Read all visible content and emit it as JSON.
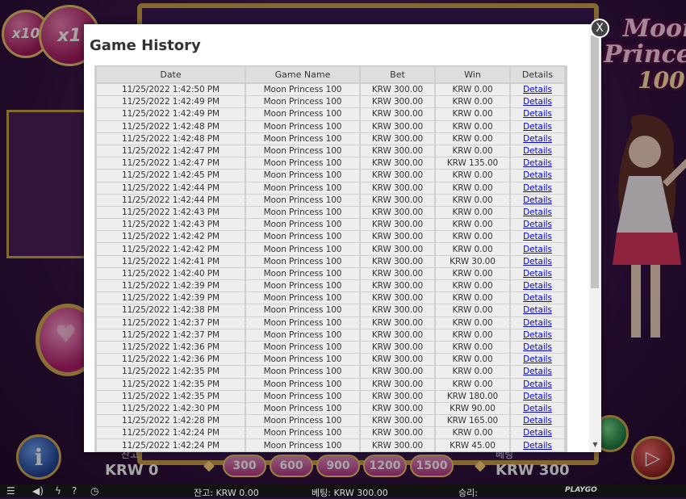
{
  "game": {
    "multipliers": [
      "x10",
      "x1"
    ],
    "logo_line1": "Moon",
    "logo_line2": "Princess",
    "logo_line3": "100",
    "balance_label": "잔고",
    "balance_value": "KRW 0",
    "bet_label": "베팅",
    "bet_value": "KRW 300",
    "bet_options": [
      "300",
      "600",
      "900",
      "1200",
      "1500"
    ]
  },
  "status_bar": {
    "balance_text": "잔고: KRW 0.00",
    "bet_text": "베팅: KRW 300.00",
    "win_text": "승리:",
    "provider": "PLAYGO"
  },
  "modal": {
    "title": "Game History",
    "close_label": "X",
    "columns": [
      "Date",
      "Game Name",
      "Bet",
      "Win",
      "Details"
    ],
    "rows": [
      {
        "date": "11/25/2022 1:42:50 PM",
        "game": "Moon Princess 100",
        "bet": "KRW 300.00",
        "win": "KRW 0.00",
        "details": "Details"
      },
      {
        "date": "11/25/2022 1:42:49 PM",
        "game": "Moon Princess 100",
        "bet": "KRW 300.00",
        "win": "KRW 0.00",
        "details": "Details"
      },
      {
        "date": "11/25/2022 1:42:49 PM",
        "game": "Moon Princess 100",
        "bet": "KRW 300.00",
        "win": "KRW 0.00",
        "details": "Details"
      },
      {
        "date": "11/25/2022 1:42:48 PM",
        "game": "Moon Princess 100",
        "bet": "KRW 300.00",
        "win": "KRW 0.00",
        "details": "Details"
      },
      {
        "date": "11/25/2022 1:42:48 PM",
        "game": "Moon Princess 100",
        "bet": "KRW 300.00",
        "win": "KRW 0.00",
        "details": "Details"
      },
      {
        "date": "11/25/2022 1:42:47 PM",
        "game": "Moon Princess 100",
        "bet": "KRW 300.00",
        "win": "KRW 0.00",
        "details": "Details"
      },
      {
        "date": "11/25/2022 1:42:47 PM",
        "game": "Moon Princess 100",
        "bet": "KRW 300.00",
        "win": "KRW 135.00",
        "details": "Details"
      },
      {
        "date": "11/25/2022 1:42:45 PM",
        "game": "Moon Princess 100",
        "bet": "KRW 300.00",
        "win": "KRW 0.00",
        "details": "Details"
      },
      {
        "date": "11/25/2022 1:42:44 PM",
        "game": "Moon Princess 100",
        "bet": "KRW 300.00",
        "win": "KRW 0.00",
        "details": "Details"
      },
      {
        "date": "11/25/2022 1:42:44 PM",
        "game": "Moon Princess 100",
        "bet": "KRW 300.00",
        "win": "KRW 0.00",
        "details": "Details"
      },
      {
        "date": "11/25/2022 1:42:43 PM",
        "game": "Moon Princess 100",
        "bet": "KRW 300.00",
        "win": "KRW 0.00",
        "details": "Details"
      },
      {
        "date": "11/25/2022 1:42:43 PM",
        "game": "Moon Princess 100",
        "bet": "KRW 300.00",
        "win": "KRW 0.00",
        "details": "Details"
      },
      {
        "date": "11/25/2022 1:42:42 PM",
        "game": "Moon Princess 100",
        "bet": "KRW 300.00",
        "win": "KRW 0.00",
        "details": "Details"
      },
      {
        "date": "11/25/2022 1:42:42 PM",
        "game": "Moon Princess 100",
        "bet": "KRW 300.00",
        "win": "KRW 0.00",
        "details": "Details"
      },
      {
        "date": "11/25/2022 1:42:41 PM",
        "game": "Moon Princess 100",
        "bet": "KRW 300.00",
        "win": "KRW 30.00",
        "details": "Details"
      },
      {
        "date": "11/25/2022 1:42:40 PM",
        "game": "Moon Princess 100",
        "bet": "KRW 300.00",
        "win": "KRW 0.00",
        "details": "Details"
      },
      {
        "date": "11/25/2022 1:42:39 PM",
        "game": "Moon Princess 100",
        "bet": "KRW 300.00",
        "win": "KRW 0.00",
        "details": "Details"
      },
      {
        "date": "11/25/2022 1:42:39 PM",
        "game": "Moon Princess 100",
        "bet": "KRW 300.00",
        "win": "KRW 0.00",
        "details": "Details"
      },
      {
        "date": "11/25/2022 1:42:38 PM",
        "game": "Moon Princess 100",
        "bet": "KRW 300.00",
        "win": "KRW 0.00",
        "details": "Details"
      },
      {
        "date": "11/25/2022 1:42:37 PM",
        "game": "Moon Princess 100",
        "bet": "KRW 300.00",
        "win": "KRW 0.00",
        "details": "Details"
      },
      {
        "date": "11/25/2022 1:42:37 PM",
        "game": "Moon Princess 100",
        "bet": "KRW 300.00",
        "win": "KRW 0.00",
        "details": "Details"
      },
      {
        "date": "11/25/2022 1:42:36 PM",
        "game": "Moon Princess 100",
        "bet": "KRW 300.00",
        "win": "KRW 0.00",
        "details": "Details"
      },
      {
        "date": "11/25/2022 1:42:36 PM",
        "game": "Moon Princess 100",
        "bet": "KRW 300.00",
        "win": "KRW 0.00",
        "details": "Details"
      },
      {
        "date": "11/25/2022 1:42:35 PM",
        "game": "Moon Princess 100",
        "bet": "KRW 300.00",
        "win": "KRW 0.00",
        "details": "Details"
      },
      {
        "date": "11/25/2022 1:42:35 PM",
        "game": "Moon Princess 100",
        "bet": "KRW 300.00",
        "win": "KRW 0.00",
        "details": "Details"
      },
      {
        "date": "11/25/2022 1:42:35 PM",
        "game": "Moon Princess 100",
        "bet": "KRW 300.00",
        "win": "KRW 180.00",
        "details": "Details"
      },
      {
        "date": "11/25/2022 1:42:30 PM",
        "game": "Moon Princess 100",
        "bet": "KRW 300.00",
        "win": "KRW 90.00",
        "details": "Details"
      },
      {
        "date": "11/25/2022 1:42:28 PM",
        "game": "Moon Princess 100",
        "bet": "KRW 300.00",
        "win": "KRW 165.00",
        "details": "Details"
      },
      {
        "date": "11/25/2022 1:42:24 PM",
        "game": "Moon Princess 100",
        "bet": "KRW 300.00",
        "win": "KRW 0.00",
        "details": "Details"
      },
      {
        "date": "11/25/2022 1:42:24 PM",
        "game": "Moon Princess 100",
        "bet": "KRW 300.00",
        "win": "KRW 45.00",
        "details": "Details"
      }
    ]
  },
  "colors": {
    "link": "#0000ee",
    "row_bg": "#eeeeee",
    "header_bg": "#dedede",
    "table_border": "#cfcfcf"
  },
  "icons": [
    "menu-icon",
    "sound-icon",
    "lightning-icon",
    "help-icon",
    "history-icon",
    "heart-icon",
    "info-icon",
    "spin-icon"
  ]
}
